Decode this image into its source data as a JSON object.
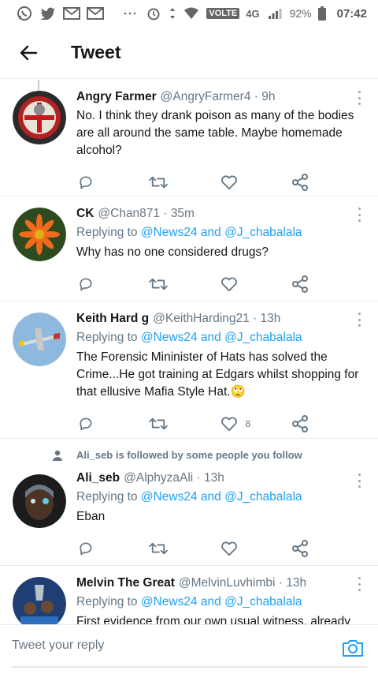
{
  "status_bar": {
    "volte": "VOLTE",
    "network": "4G",
    "battery": "92%",
    "time": "07:42"
  },
  "header": {
    "title": "Tweet"
  },
  "tweets": [
    {
      "name": "Angry Farmer",
      "handle": "@AngryFarmer4 · 9h",
      "text": "No. I think they drank poison as many of the bodies are all around the same table. Maybe homemade alcohol?"
    },
    {
      "name": "CK",
      "handle": "@Chan871 · 35m",
      "replying_prefix": "Replying to ",
      "replying_to": "@News24 and @J_chabalala",
      "text": "Why has no one considered drugs?"
    },
    {
      "name": "Keith Hard g",
      "handle": "@KeithHarding21 · 13h",
      "replying_prefix": "Replying to ",
      "replying_to": "@News24 and @J_chabalala",
      "text": "The Forensic Mininister of Hats has solved the Crime...He got training at Edgars whilst shopping for that ellusive Mafia Style Hat.🙄",
      "like_count": "8"
    },
    {
      "social_context": "Ali_seb is followed by some people you follow",
      "name": "Ali_seb",
      "handle": "@AlphyzaAli · 13h",
      "replying_prefix": "Replying to ",
      "replying_to": "@News24 and @J_chabalala",
      "text": "Eban"
    },
    {
      "name": "Melvin The Great",
      "handle": "@MelvinLuvhimbi · 13h",
      "replying_prefix": "Replying to ",
      "replying_to": "@News24 and @J_chabalala",
      "text": "First evidence from our own usual witness. already"
    }
  ],
  "compose": {
    "placeholder": "Tweet your reply"
  },
  "icons": {
    "reply": "reply-icon",
    "retweet": "retweet-icon",
    "like": "like-icon",
    "share": "share-icon",
    "camera": "camera-icon",
    "back": "back-arrow-icon"
  },
  "colors": {
    "link": "#1da1f2",
    "secondary_text": "#657786",
    "icon": "#657786"
  }
}
